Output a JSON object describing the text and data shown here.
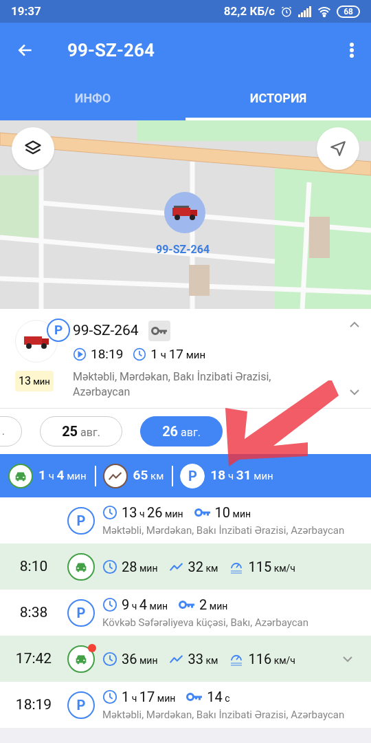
{
  "status_bar": {
    "time": "19:37",
    "speed": "82,2 КБ/с",
    "battery": "68"
  },
  "app_bar": {
    "title": "99-SZ-264"
  },
  "tabs": [
    {
      "label": "ИНФО",
      "selected": false
    },
    {
      "label": "ИСТОРИЯ",
      "selected": true
    }
  ],
  "map": {
    "marker_label": "99-SZ-264"
  },
  "vehicle_card": {
    "status_symbol": "P",
    "name": "99-SZ-264",
    "start_time": "18:19",
    "duration": "1 ч 17 мин",
    "badge": "13 мин",
    "address": "Məktəbli, Mərdəkan, Bakı İnzibati Ərazisi, Azərbaycan"
  },
  "date_chips": [
    {
      "label": ".",
      "selected": false
    },
    {
      "label": "25 авг.",
      "selected": false
    },
    {
      "label": "26 авг.",
      "selected": true
    }
  ],
  "summary": [
    {
      "kind": "drive",
      "value": "1 ч 4 мин"
    },
    {
      "kind": "distance",
      "value": "65 км"
    },
    {
      "kind": "parking",
      "symbol": "P",
      "value": "18 ч 31 мин"
    }
  ],
  "timeline": [
    {
      "kind": "parking",
      "symbol": "P",
      "duration": "13 ч 26 мин",
      "ignition": "10 мин",
      "address": "Məktəbli, Mərdəkan, Bakı İnzibati Ərazisi, Azərbaycan",
      "alert": false,
      "expandable": false
    },
    {
      "kind": "trip",
      "time": "8:10",
      "duration": "28 мин",
      "distance": "32 км",
      "max_speed": "115 км/ч",
      "alert": false,
      "expandable": false
    },
    {
      "kind": "parking",
      "symbol": "P",
      "time": "8:38",
      "duration": "9 ч 4 мин",
      "ignition": "2 мин",
      "address": "Kövkəb Səfərəliyeva küçəsi, Bakı, Azərbaycan",
      "alert": false,
      "expandable": false
    },
    {
      "kind": "trip",
      "time": "17:42",
      "duration": "36 мин",
      "distance": "33 км",
      "max_speed": "116 км/ч",
      "alert": true,
      "expandable": true
    },
    {
      "kind": "parking",
      "symbol": "P",
      "time": "18:19",
      "duration": "1 ч 17 мин",
      "ignition": "14 с",
      "address": "Məktəbli, Mərdəkan, Bakı İnzibati Ərazisi, Azərbaycan",
      "alert": false,
      "expandable": false
    }
  ]
}
